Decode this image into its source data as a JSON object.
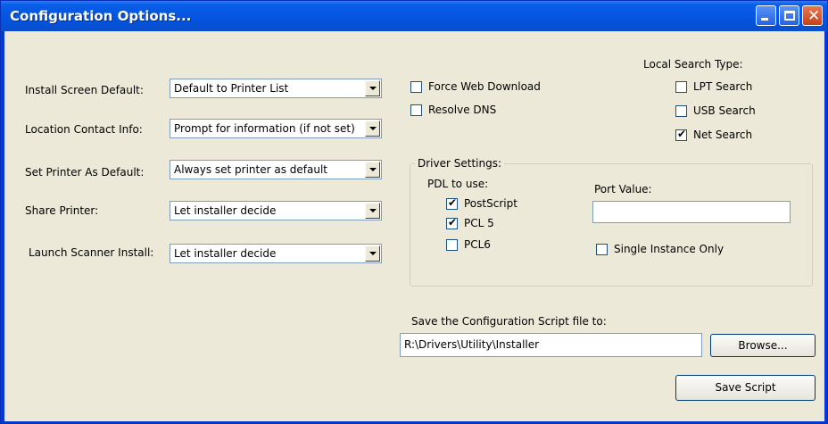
{
  "window": {
    "title": "Configuration Options...",
    "controls": {
      "minimize": "minimize-icon",
      "maximize": "maximize-icon",
      "close": "close-icon"
    }
  },
  "left_settings": [
    {
      "label": "Install Screen Default:",
      "value": "Default to Printer List"
    },
    {
      "label": "Location Contact Info:",
      "value": "Prompt for information (if not set)"
    },
    {
      "label": "Set Printer As Default:",
      "value": "Always set printer as default"
    },
    {
      "label": "Share Printer:",
      "value": "Let installer decide"
    },
    {
      "label": "Launch Scanner Install:",
      "value": "Let installer decide"
    }
  ],
  "options": {
    "force_web_download": {
      "label": "Force Web Download",
      "checked": false
    },
    "resolve_dns": {
      "label": "Resolve DNS",
      "checked": false
    }
  },
  "local_search": {
    "title": "Local Search Type:",
    "items": [
      {
        "label": "LPT Search",
        "checked": false
      },
      {
        "label": "USB Search",
        "checked": false
      },
      {
        "label": "Net Search",
        "checked": true
      }
    ]
  },
  "driver_settings": {
    "title": "Driver Settings:",
    "pdl_title": "PDL to use:",
    "pdl_items": [
      {
        "label": "PostScript",
        "checked": true
      },
      {
        "label": "PCL 5",
        "checked": true
      },
      {
        "label": "PCL6",
        "checked": false
      }
    ],
    "port_value_label": "Port Value:",
    "port_value": "",
    "single_instance": {
      "label": "Single Instance Only",
      "checked": false
    }
  },
  "save": {
    "label": "Save the Configuration Script file to:",
    "path": "R:\\Drivers\\Utility\\Installer",
    "browse_label": "Browse...",
    "save_script_label": "Save Script"
  },
  "colors": {
    "titlebar": "#0656e2",
    "client_bg": "#ece9d8",
    "close_button": "#c4421a"
  }
}
